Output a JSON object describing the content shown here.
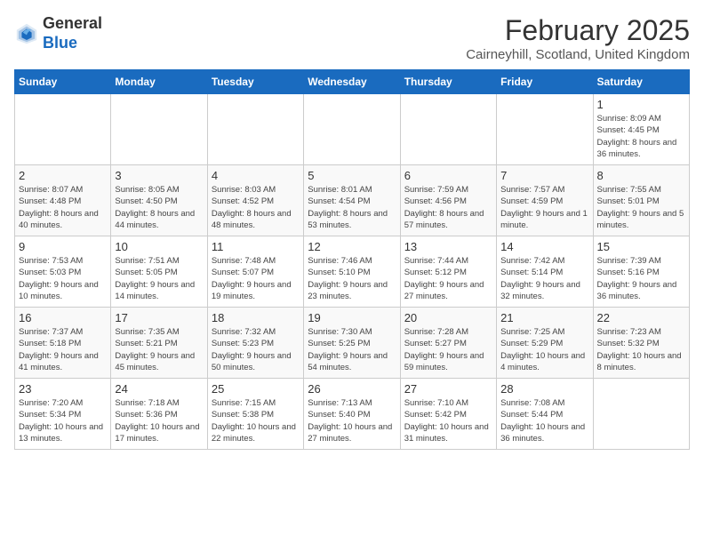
{
  "header": {
    "logo_general": "General",
    "logo_blue": "Blue",
    "title": "February 2025",
    "subtitle": "Cairneyhill, Scotland, United Kingdom"
  },
  "weekdays": [
    "Sunday",
    "Monday",
    "Tuesday",
    "Wednesday",
    "Thursday",
    "Friday",
    "Saturday"
  ],
  "weeks": [
    [
      {
        "day": "",
        "info": ""
      },
      {
        "day": "",
        "info": ""
      },
      {
        "day": "",
        "info": ""
      },
      {
        "day": "",
        "info": ""
      },
      {
        "day": "",
        "info": ""
      },
      {
        "day": "",
        "info": ""
      },
      {
        "day": "1",
        "info": "Sunrise: 8:09 AM\nSunset: 4:45 PM\nDaylight: 8 hours and 36 minutes."
      }
    ],
    [
      {
        "day": "2",
        "info": "Sunrise: 8:07 AM\nSunset: 4:48 PM\nDaylight: 8 hours and 40 minutes."
      },
      {
        "day": "3",
        "info": "Sunrise: 8:05 AM\nSunset: 4:50 PM\nDaylight: 8 hours and 44 minutes."
      },
      {
        "day": "4",
        "info": "Sunrise: 8:03 AM\nSunset: 4:52 PM\nDaylight: 8 hours and 48 minutes."
      },
      {
        "day": "5",
        "info": "Sunrise: 8:01 AM\nSunset: 4:54 PM\nDaylight: 8 hours and 53 minutes."
      },
      {
        "day": "6",
        "info": "Sunrise: 7:59 AM\nSunset: 4:56 PM\nDaylight: 8 hours and 57 minutes."
      },
      {
        "day": "7",
        "info": "Sunrise: 7:57 AM\nSunset: 4:59 PM\nDaylight: 9 hours and 1 minute."
      },
      {
        "day": "8",
        "info": "Sunrise: 7:55 AM\nSunset: 5:01 PM\nDaylight: 9 hours and 5 minutes."
      }
    ],
    [
      {
        "day": "9",
        "info": "Sunrise: 7:53 AM\nSunset: 5:03 PM\nDaylight: 9 hours and 10 minutes."
      },
      {
        "day": "10",
        "info": "Sunrise: 7:51 AM\nSunset: 5:05 PM\nDaylight: 9 hours and 14 minutes."
      },
      {
        "day": "11",
        "info": "Sunrise: 7:48 AM\nSunset: 5:07 PM\nDaylight: 9 hours and 19 minutes."
      },
      {
        "day": "12",
        "info": "Sunrise: 7:46 AM\nSunset: 5:10 PM\nDaylight: 9 hours and 23 minutes."
      },
      {
        "day": "13",
        "info": "Sunrise: 7:44 AM\nSunset: 5:12 PM\nDaylight: 9 hours and 27 minutes."
      },
      {
        "day": "14",
        "info": "Sunrise: 7:42 AM\nSunset: 5:14 PM\nDaylight: 9 hours and 32 minutes."
      },
      {
        "day": "15",
        "info": "Sunrise: 7:39 AM\nSunset: 5:16 PM\nDaylight: 9 hours and 36 minutes."
      }
    ],
    [
      {
        "day": "16",
        "info": "Sunrise: 7:37 AM\nSunset: 5:18 PM\nDaylight: 9 hours and 41 minutes."
      },
      {
        "day": "17",
        "info": "Sunrise: 7:35 AM\nSunset: 5:21 PM\nDaylight: 9 hours and 45 minutes."
      },
      {
        "day": "18",
        "info": "Sunrise: 7:32 AM\nSunset: 5:23 PM\nDaylight: 9 hours and 50 minutes."
      },
      {
        "day": "19",
        "info": "Sunrise: 7:30 AM\nSunset: 5:25 PM\nDaylight: 9 hours and 54 minutes."
      },
      {
        "day": "20",
        "info": "Sunrise: 7:28 AM\nSunset: 5:27 PM\nDaylight: 9 hours and 59 minutes."
      },
      {
        "day": "21",
        "info": "Sunrise: 7:25 AM\nSunset: 5:29 PM\nDaylight: 10 hours and 4 minutes."
      },
      {
        "day": "22",
        "info": "Sunrise: 7:23 AM\nSunset: 5:32 PM\nDaylight: 10 hours and 8 minutes."
      }
    ],
    [
      {
        "day": "23",
        "info": "Sunrise: 7:20 AM\nSunset: 5:34 PM\nDaylight: 10 hours and 13 minutes."
      },
      {
        "day": "24",
        "info": "Sunrise: 7:18 AM\nSunset: 5:36 PM\nDaylight: 10 hours and 17 minutes."
      },
      {
        "day": "25",
        "info": "Sunrise: 7:15 AM\nSunset: 5:38 PM\nDaylight: 10 hours and 22 minutes."
      },
      {
        "day": "26",
        "info": "Sunrise: 7:13 AM\nSunset: 5:40 PM\nDaylight: 10 hours and 27 minutes."
      },
      {
        "day": "27",
        "info": "Sunrise: 7:10 AM\nSunset: 5:42 PM\nDaylight: 10 hours and 31 minutes."
      },
      {
        "day": "28",
        "info": "Sunrise: 7:08 AM\nSunset: 5:44 PM\nDaylight: 10 hours and 36 minutes."
      },
      {
        "day": "",
        "info": ""
      }
    ]
  ]
}
